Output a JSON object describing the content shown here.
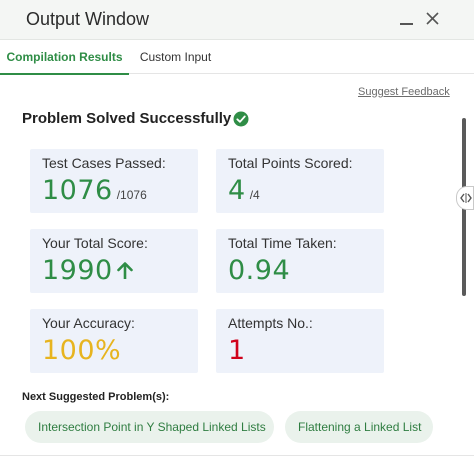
{
  "window": {
    "title": "Output Window"
  },
  "tabs": [
    {
      "label": "Compilation Results",
      "active": true
    },
    {
      "label": "Custom Input",
      "active": false
    }
  ],
  "feedback_link": "Suggest Feedback",
  "status": {
    "headline": "Problem Solved Successfully",
    "icon": "check-circle-icon"
  },
  "stats": {
    "test_cases": {
      "label": "Test Cases Passed:",
      "value": "1076",
      "denominator": "/1076"
    },
    "points": {
      "label": "Total Points Scored:",
      "value": "4",
      "denominator": "/4"
    },
    "score": {
      "label": "Your Total Score:",
      "value": "1990",
      "icon": "arrow-up-icon"
    },
    "time": {
      "label": "Total Time Taken:",
      "value": "0.94"
    },
    "accuracy": {
      "label": "Your Accuracy:",
      "value": "100%"
    },
    "attempts": {
      "label": "Attempts No.:",
      "value": "1"
    }
  },
  "next": {
    "label": "Next Suggested Problem(s):",
    "problems": [
      "Intersection Point in Y Shaped Linked Lists",
      "Flattening a Linked List"
    ]
  },
  "colors": {
    "accent_green": "#2f8d46",
    "accuracy_orange": "#e7b41f",
    "attempts_red": "#d0021b",
    "card_bg": "#eef2fa",
    "chip_bg": "#eaf2ec"
  }
}
